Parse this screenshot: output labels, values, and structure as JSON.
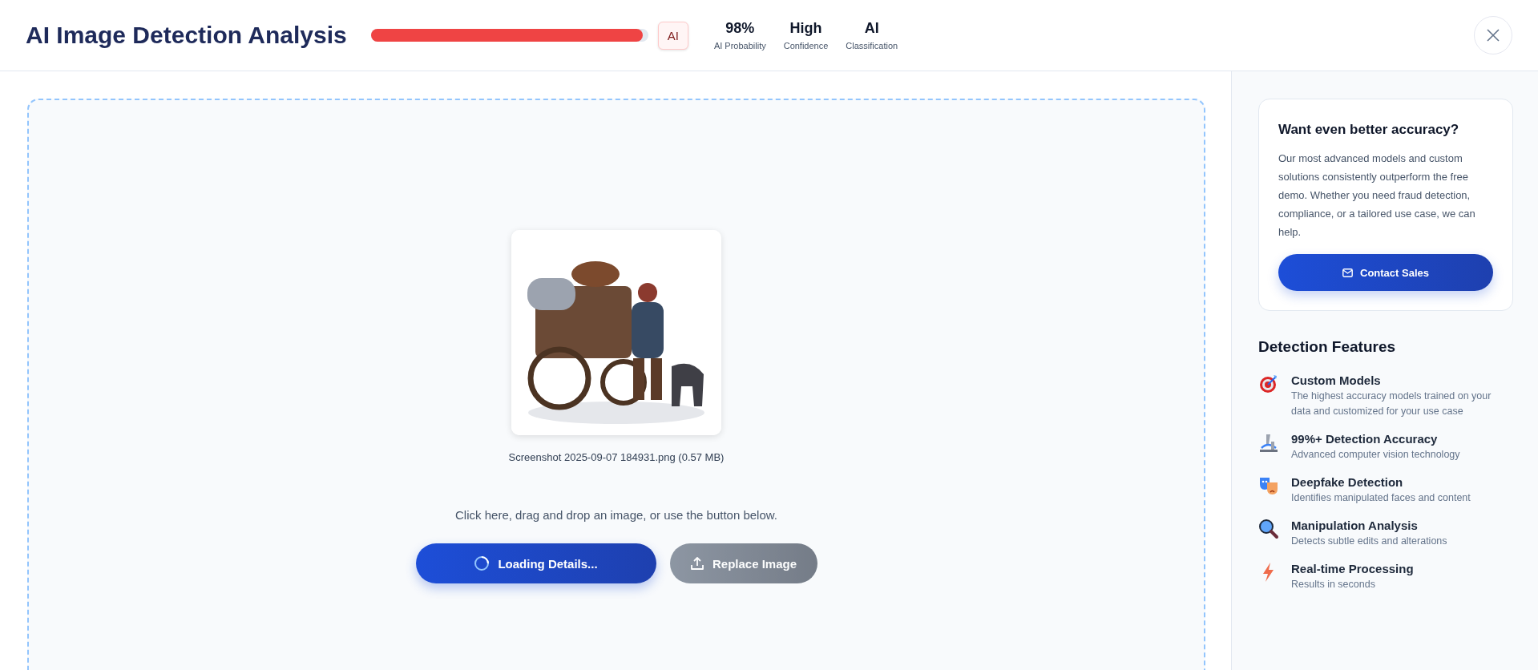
{
  "header": {
    "title": "AI Image Detection Analysis",
    "probability_bar": {
      "level": 0.98
    },
    "badge": "AI",
    "stats": [
      {
        "value": "98%",
        "label": "AI Probability"
      },
      {
        "value": "High",
        "label": "Confidence"
      },
      {
        "value": "AI",
        "label": "Classification"
      }
    ]
  },
  "upload": {
    "file_caption": "Screenshot 2025-09-07 184931.png (0.57 MB)",
    "instruction": "Click here, drag and drop an image, or use the button below.",
    "buttons": [
      {
        "kind": "primary",
        "label": "Loading Details...",
        "loading": true,
        "disabled": false
      },
      {
        "kind": "secondary",
        "label": "Replace Image",
        "loading": false,
        "disabled": true
      }
    ]
  },
  "sidebar": {
    "promo": {
      "title": "Want even better accuracy?",
      "text": "Our most advanced models and custom solutions consistently outperform the free demo. Whether you need fraud detection, compliance, or a tailored use case, we can help.",
      "button": "Contact Sales"
    },
    "features_heading": "Detection Features",
    "features": [
      {
        "title": "Custom Models",
        "text": "The highest accuracy models trained on your data and customized for your use case"
      },
      {
        "title": "99%+ Detection Accuracy",
        "text": "Advanced computer vision technology"
      },
      {
        "title": "Deepfake Detection",
        "text": "Identifies manipulated faces and content"
      },
      {
        "title": "Manipulation Analysis",
        "text": "Detects subtle edits and alterations"
      },
      {
        "title": "Real-time Processing",
        "text": "Results in seconds"
      }
    ]
  }
}
